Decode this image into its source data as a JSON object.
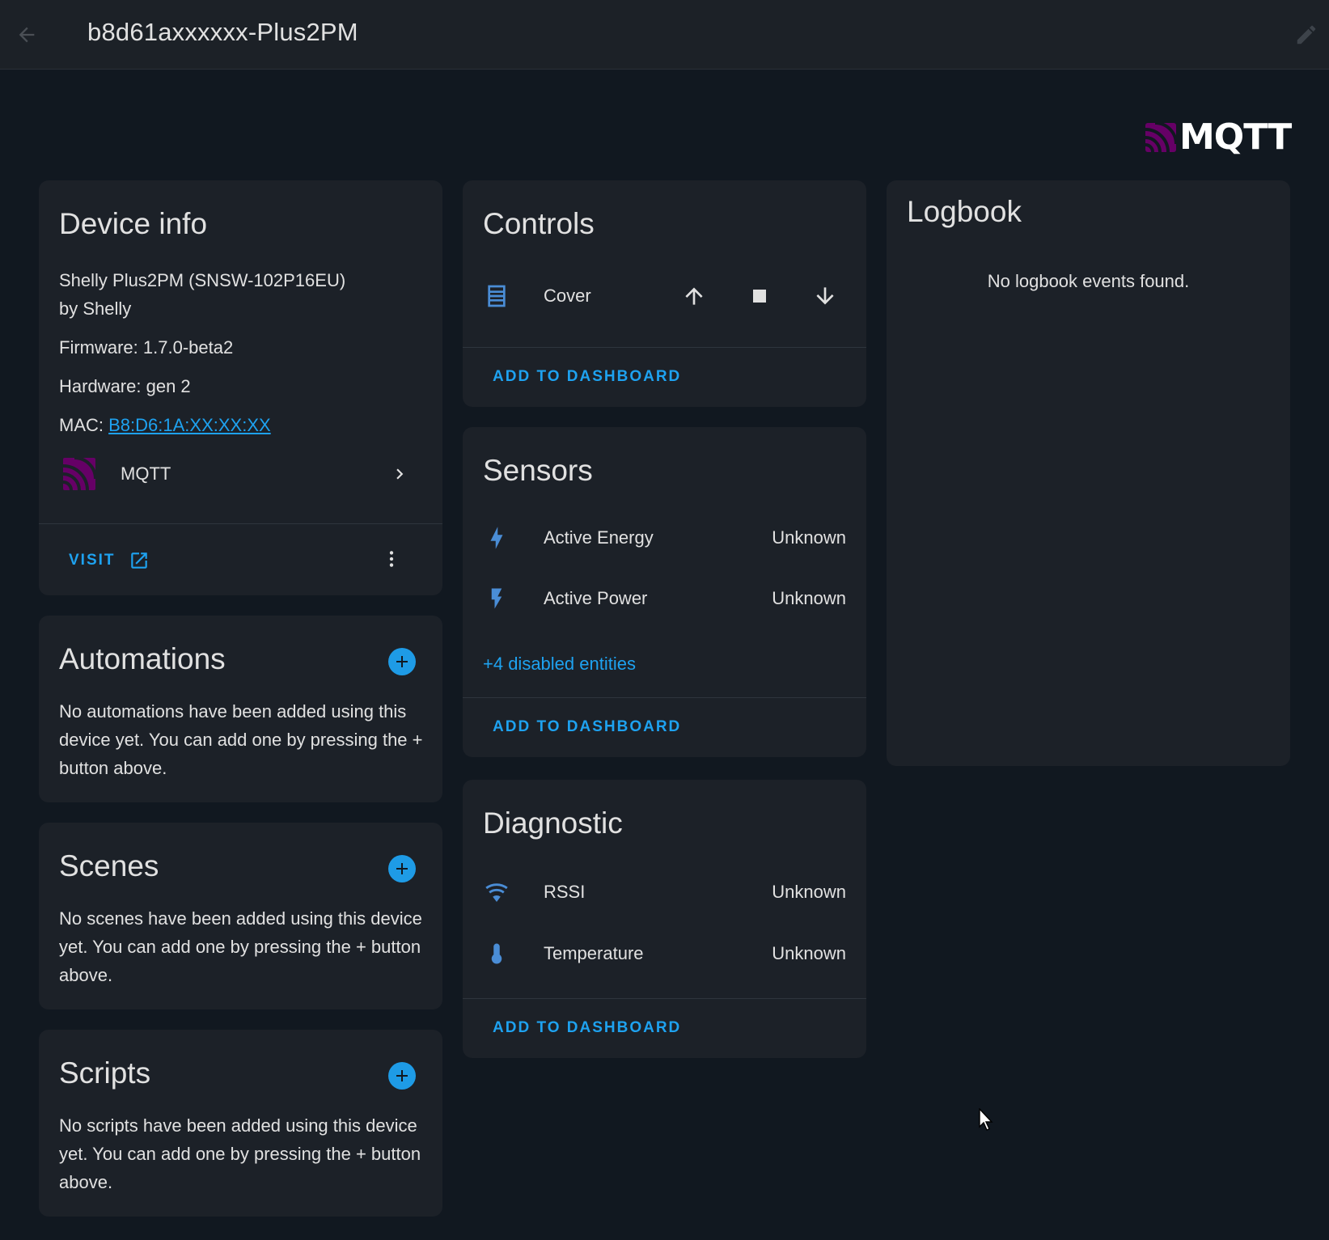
{
  "header": {
    "title": "b8d61axxxxxx-Plus2PM",
    "back_icon": "arrow-left-icon",
    "edit_icon": "pencil-icon"
  },
  "brand": {
    "name": "MQTT",
    "color": "#660066"
  },
  "device_info": {
    "title": "Device info",
    "model": "Shelly Plus2PM (SNSW-102P16EU)",
    "manufacturer": "by Shelly",
    "firmware": "Firmware: 1.7.0-beta2",
    "hardware": "Hardware: gen 2",
    "mac_label": "MAC: ",
    "mac_value": "B8:D6:1A:XX:XX:XX",
    "integration": "MQTT",
    "visit_label": "VISIT"
  },
  "automations": {
    "title": "Automations",
    "body": "No automations have been added using this device yet. You can add one by pressing the + button above."
  },
  "scenes": {
    "title": "Scenes",
    "body": "No scenes have been added using this device yet. You can add one by pressing the + button above."
  },
  "scripts": {
    "title": "Scripts",
    "body": "No scripts have been added using this device yet. You can add one by pressing the + button above."
  },
  "controls": {
    "title": "Controls",
    "entities": [
      {
        "name": "Cover",
        "icon": "window-shutter-icon"
      }
    ],
    "add_label": "ADD TO DASHBOARD"
  },
  "sensors": {
    "title": "Sensors",
    "entities": [
      {
        "name": "Active Energy",
        "state": "Unknown",
        "icon": "lightning-bolt-icon"
      },
      {
        "name": "Active Power",
        "state": "Unknown",
        "icon": "flash-icon"
      }
    ],
    "disabled_label": "+4 disabled entities",
    "add_label": "ADD TO DASHBOARD"
  },
  "diagnostic": {
    "title": "Diagnostic",
    "entities": [
      {
        "name": "RSSI",
        "state": "Unknown",
        "icon": "wifi-icon"
      },
      {
        "name": "Temperature",
        "state": "Unknown",
        "icon": "thermometer-icon"
      }
    ],
    "add_label": "ADD TO DASHBOARD"
  },
  "logbook": {
    "title": "Logbook",
    "empty": "No logbook events found."
  },
  "colors": {
    "accent": "#1ea2f0",
    "background": "#111820",
    "card": "#1c2128",
    "entity_icon": "#4a8dd6"
  }
}
